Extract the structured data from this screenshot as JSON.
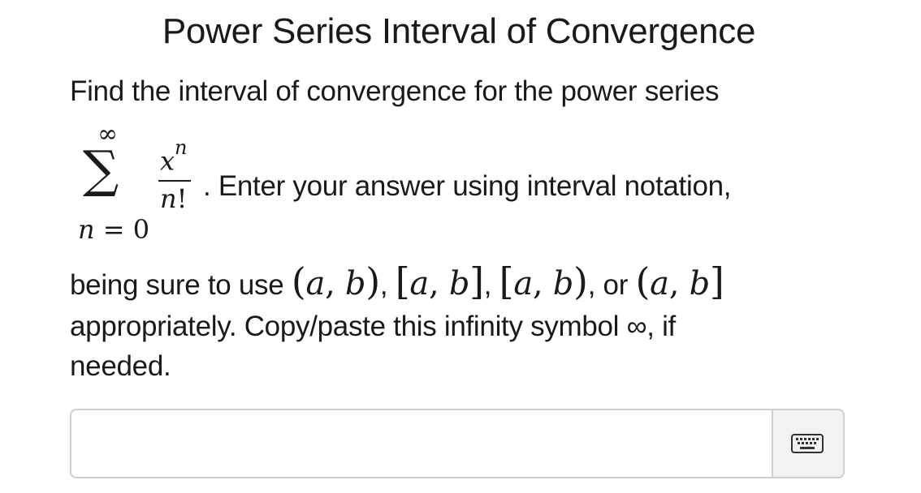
{
  "page": {
    "title": "Power Series Interval of Convergence"
  },
  "question": {
    "intro": "Find the interval of convergence for the power series",
    "sum_upper": "∞",
    "sum_symbol": "∑",
    "sum_lower_var": "n",
    "sum_lower_eq": "= 0",
    "frac_num_base": "x",
    "frac_num_exp": "n",
    "frac_den_var": "n",
    "frac_den_bang": "!",
    "after_formula": ".  Enter your answer using interval notation,",
    "line3_prefix": "being sure to use",
    "intervals": [
      {
        "open": "(",
        "a": "a",
        "comma": ",",
        "b": "b",
        "close": ")"
      },
      {
        "open": "[",
        "a": "a",
        "comma": ",",
        "b": "b",
        "close": "]"
      },
      {
        "open": "[",
        "a": "a",
        "comma": ",",
        "b": "b",
        "close": ")"
      },
      {
        "open": "(",
        "a": "a",
        "comma": ",",
        "b": "b",
        "close": "]"
      }
    ],
    "sep": ",",
    "or_word": ", or",
    "line4": "appropriately.  Copy/paste this infinity symbol ∞, if",
    "line5": "needed."
  },
  "answer_field": {
    "value": "",
    "placeholder": ""
  },
  "icons": {
    "keyboard": "keyboard-icon"
  }
}
